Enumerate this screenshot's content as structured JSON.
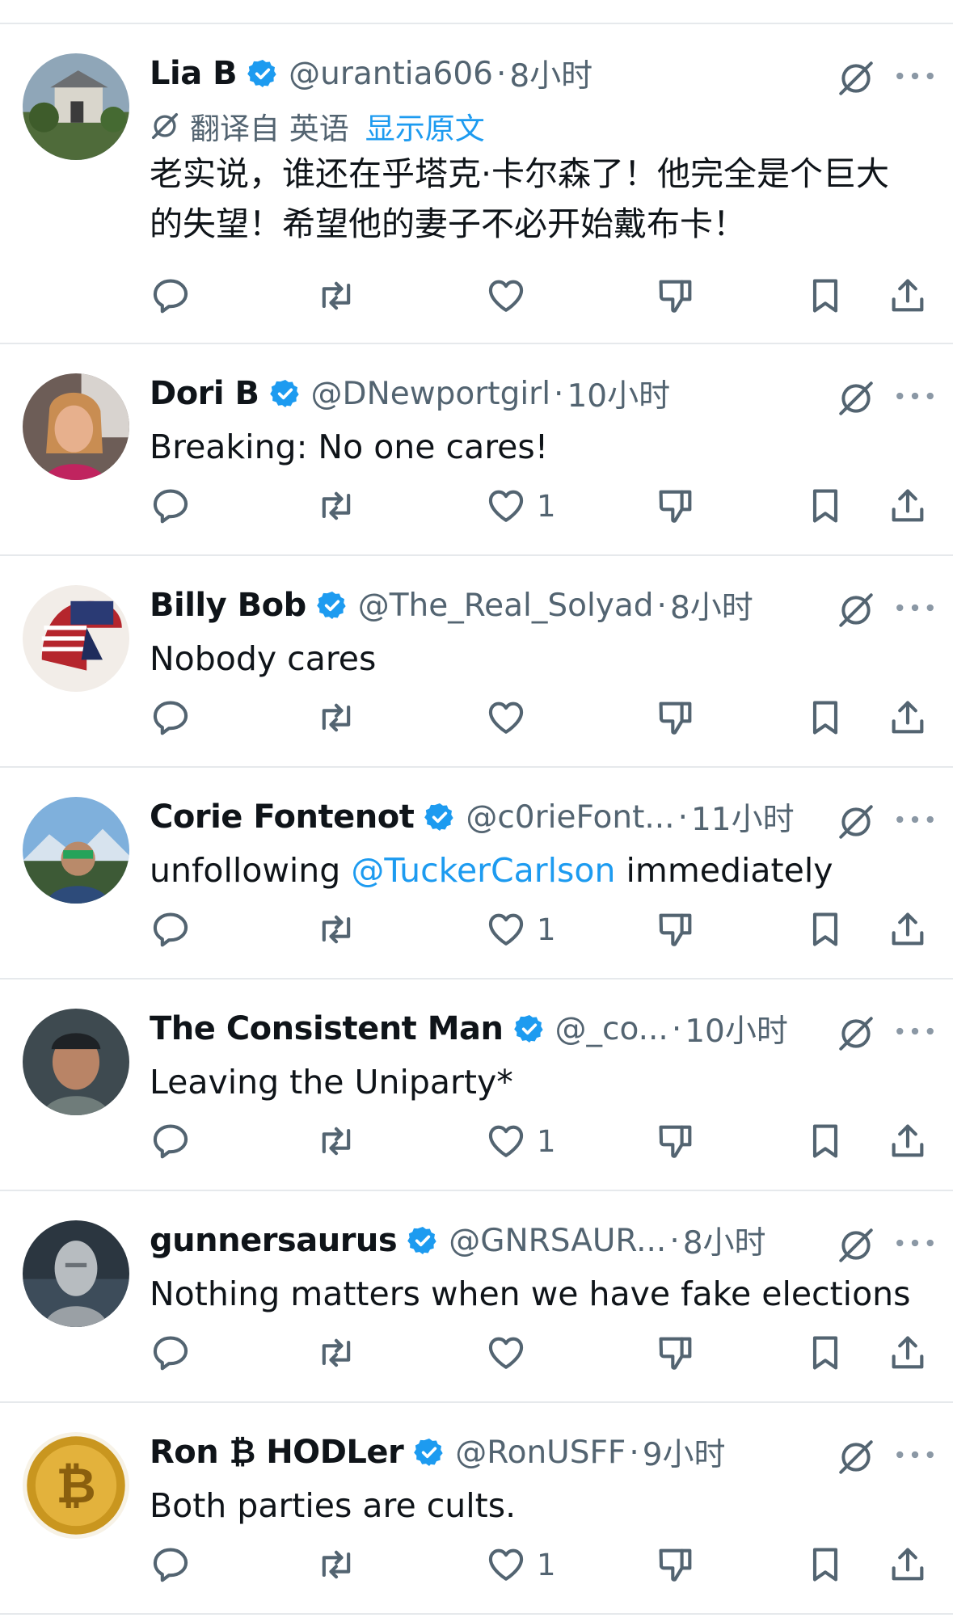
{
  "translation": {
    "label": "翻译自 英语",
    "show_original": "显示原文"
  },
  "tweets": [
    {
      "name": "Lia B",
      "handle": "@urantia606",
      "dot": "·",
      "time": "8小时",
      "translated": true,
      "text": "老实说，谁还在乎塔克·卡尔森了！他完全是个巨大的失望！希望他的妻子不必开始戴布卡！",
      "likes": "",
      "avatar": "house-photo"
    },
    {
      "name": "Dori B",
      "handle": "@DNewportgirl",
      "dot": "·",
      "time": "10小时",
      "translated": false,
      "text": "Breaking: No one cares!",
      "likes": "1",
      "avatar": "woman-photo"
    },
    {
      "name": "Billy Bob",
      "handle": "@The_Real_Solyad",
      "dot": "·",
      "time": "8小时",
      "translated": false,
      "text": "Nobody cares",
      "likes": "",
      "avatar": "spartan-flag"
    },
    {
      "name": "Corie Fontenot",
      "handle": "@c0rieFont...",
      "dot": "·",
      "time": "11小时",
      "translated": false,
      "text_before": "unfollowing ",
      "mention": "@TuckerCarlson",
      "text_after": " immediately",
      "likes": "1",
      "avatar": "man-mountains"
    },
    {
      "name": "The Consistent Man",
      "handle": "@_co...",
      "dot": "·",
      "time": "10小时",
      "translated": false,
      "text": "Leaving the Uniparty*",
      "likes": "1",
      "avatar": "man-cap"
    },
    {
      "name": "gunnersaurus",
      "handle": "@GNRSAUR...",
      "dot": "·",
      "time": "8小时",
      "translated": false,
      "text": "Nothing matters when we have fake elections",
      "likes": "",
      "avatar": "silver-statue"
    },
    {
      "name": "Ron ₿ HODLer",
      "handle": "@RonUSFF",
      "dot": "·",
      "time": "9小时",
      "translated": false,
      "text": "Both parties are cults.",
      "likes": "1",
      "avatar": "bitcoin-coin"
    }
  ],
  "icons": {
    "verified": "verified-badge-icon",
    "grok": "grok-icon",
    "more": "more-icon",
    "reply": "reply-icon",
    "retweet": "retweet-icon",
    "like": "heart-icon",
    "dislike": "dislike-icon",
    "bookmark": "bookmark-icon",
    "share": "share-icon"
  },
  "colors": {
    "accent": "#1d9bf0",
    "text": "#0f1419",
    "muted": "#536471",
    "divider": "#e6e9ec"
  }
}
